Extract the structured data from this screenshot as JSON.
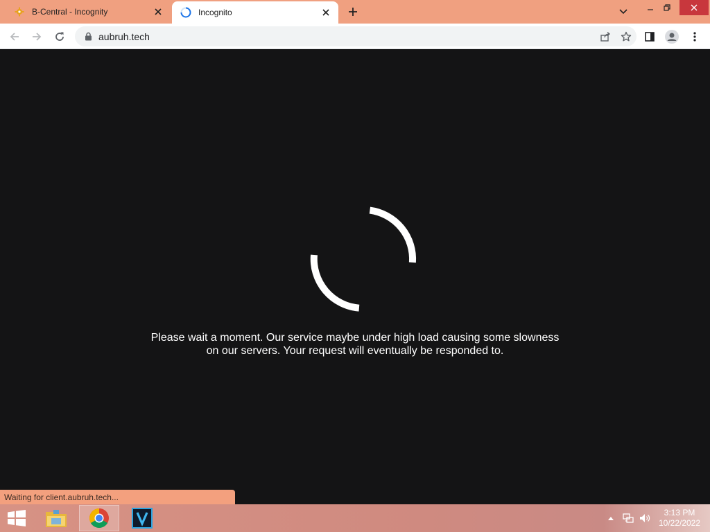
{
  "browser": {
    "tabs": [
      {
        "title": "B-Central - Incognity",
        "active": false,
        "icon": "gear-favicon-icon"
      },
      {
        "title": "Incognito",
        "active": true,
        "icon": "loading-favicon-icon"
      }
    ],
    "url": "aubruh.tech",
    "accent_color": "#f0a080"
  },
  "page": {
    "message_line1": "Please wait a moment. Our service maybe under high load causing some slowness",
    "message_line2": "on our servers. Your request will eventually be responded to.",
    "background_color": "#141415"
  },
  "status_bar": {
    "text": "Waiting for client.aubruh.tech..."
  },
  "taskbar": {
    "apps": [
      "file-explorer-icon",
      "chrome-icon",
      "v-app-icon"
    ],
    "time": "3:13 PM",
    "date": "10/22/2022"
  }
}
